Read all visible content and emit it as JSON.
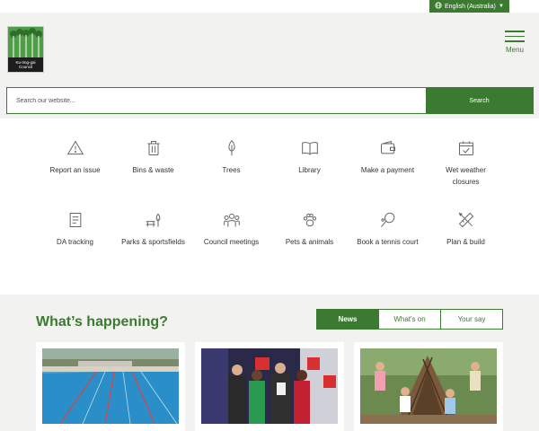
{
  "language": {
    "label": "English (Australia)"
  },
  "logo": {
    "text_line1": "Ku-ring-gai",
    "text_line2": "Council"
  },
  "menu": {
    "label": "Menu"
  },
  "search": {
    "placeholder": "Search our website...",
    "button_label": "Search"
  },
  "quicklinks": [
    {
      "label": "Report an issue",
      "icon": "warning-icon"
    },
    {
      "label": "Bins & waste",
      "icon": "bin-icon"
    },
    {
      "label": "Trees",
      "icon": "tree-icon"
    },
    {
      "label": "Library",
      "icon": "book-icon"
    },
    {
      "label": "Make a payment",
      "icon": "wallet-icon"
    },
    {
      "label": "Wet weather closures",
      "icon": "calendar-check-icon"
    },
    {
      "label": "DA tracking",
      "icon": "document-icon"
    },
    {
      "label": "Parks & sportsfields",
      "icon": "park-bench-icon"
    },
    {
      "label": "Council meetings",
      "icon": "people-icon"
    },
    {
      "label": "Pets & animals",
      "icon": "paw-icon"
    },
    {
      "label": "Book a tennis court",
      "icon": "tennis-racket-icon"
    },
    {
      "label": "Plan & build",
      "icon": "ruler-pencil-icon"
    }
  ],
  "happening": {
    "title": "What’s happening?",
    "tabs": [
      "News",
      "What's on",
      "Your say"
    ],
    "active_tab": "News"
  },
  "colors": {
    "brand_green": "#3c7a32",
    "panel_bg": "#f2f2f0"
  }
}
